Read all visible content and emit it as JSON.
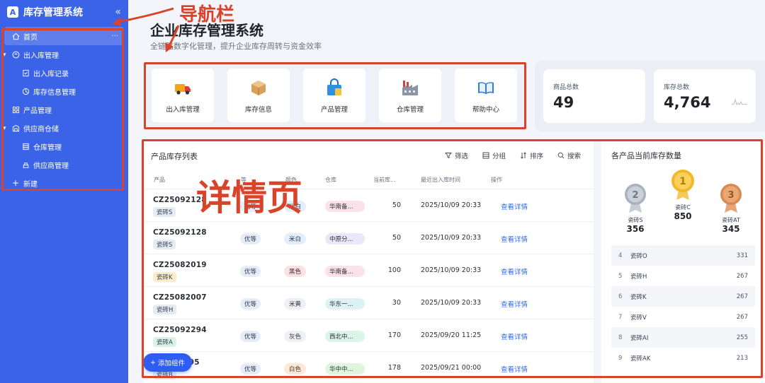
{
  "app": {
    "logo_letter": "A",
    "title": "库存管理系统"
  },
  "sidebar": {
    "items": [
      {
        "label": "首页"
      },
      {
        "label": "出入库管理"
      },
      {
        "label": "出入库记录"
      },
      {
        "label": "库存信息管理"
      },
      {
        "label": "产品管理"
      },
      {
        "label": "供应商仓储"
      },
      {
        "label": "仓库管理"
      },
      {
        "label": "供应商管理"
      },
      {
        "label": "新建"
      }
    ]
  },
  "annotations": {
    "nav": "导航栏",
    "detail": "详情页"
  },
  "header": {
    "title": "企业库存管理系统",
    "subtitle": "全链路数字化管理，提升企业库存周转与资金效率"
  },
  "quick_entries": [
    {
      "label": "出入库管理",
      "icon": "truck-icon"
    },
    {
      "label": "库存信息",
      "icon": "box-icon"
    },
    {
      "label": "产品管理",
      "icon": "bag-icon"
    },
    {
      "label": "仓库管理",
      "icon": "factory-icon"
    },
    {
      "label": "帮助中心",
      "icon": "book-icon"
    }
  ],
  "stats": [
    {
      "label": "商品总数",
      "value": "49"
    },
    {
      "label": "库存总数",
      "value": "4,764"
    }
  ],
  "list": {
    "title": "产品库存列表",
    "toolbar": {
      "filter": "筛选",
      "group": "分组",
      "sort": "排序",
      "search": "搜索"
    },
    "columns": [
      "产品",
      "等",
      "颜色",
      "仓库",
      "当前库...",
      "最近出入库时间",
      "操作"
    ],
    "rows": [
      {
        "code": "CZ25092128",
        "product": "瓷砖S",
        "grade": "优等",
        "color": "米白",
        "warehouse": "华南备...",
        "qty": "50",
        "time": "2025/10/09 20:33",
        "action": "查看详情"
      },
      {
        "code": "CZ25092128",
        "product": "瓷砖S",
        "grade": "优等",
        "color": "米白",
        "warehouse": "中原分...",
        "qty": "50",
        "time": "2025/10/09 20:33",
        "action": "查看详情"
      },
      {
        "code": "CZ25082019",
        "product": "瓷砖K",
        "grade": "优等",
        "color": "黑色",
        "warehouse": "华南备...",
        "qty": "100",
        "time": "2025/10/09 20:33",
        "action": "查看详情"
      },
      {
        "code": "CZ25082007",
        "product": "瓷砖H",
        "grade": "优等",
        "color": "米黄",
        "warehouse": "华东一...",
        "qty": "30",
        "time": "2025/10/09 20:33",
        "action": "查看详情"
      },
      {
        "code": "CZ25092294",
        "product": "瓷砖A",
        "grade": "优等",
        "color": "灰色",
        "warehouse": "西北中...",
        "qty": "170",
        "time": "2025/09/20 11:25",
        "action": "查看详情"
      },
      {
        "code": "CZ250...95",
        "product": "瓷砖B",
        "grade": "优等",
        "color": "白色",
        "warehouse": "华中中...",
        "qty": "178",
        "time": "2025/09/21 00:00",
        "action": "查看详情"
      }
    ]
  },
  "add_widget": "添加组件",
  "ranking": {
    "title": "各产品当前库存数量",
    "podium": [
      {
        "rank": "2",
        "name": "瓷砖S",
        "value": "356"
      },
      {
        "rank": "1",
        "name": "瓷砖C",
        "value": "850"
      },
      {
        "rank": "3",
        "name": "瓷砖AT",
        "value": "345"
      }
    ],
    "list": [
      {
        "rank": "4",
        "name": "瓷砖O",
        "value": "331"
      },
      {
        "rank": "5",
        "name": "瓷砖H",
        "value": "267"
      },
      {
        "rank": "6",
        "name": "瓷砖K",
        "value": "267"
      },
      {
        "rank": "7",
        "name": "瓷砖V",
        "value": "267"
      },
      {
        "rank": "8",
        "name": "瓷砖AI",
        "value": "255"
      },
      {
        "rank": "9",
        "name": "瓷砖AK",
        "value": "213"
      }
    ]
  },
  "colors": {
    "sidebar_bg": "#3b63e7",
    "annotation_red": "#d8442a",
    "link_blue": "#2f6bf3",
    "gold": "#f2b82a",
    "silver": "#a9b3be",
    "bronze": "#d98a52"
  }
}
